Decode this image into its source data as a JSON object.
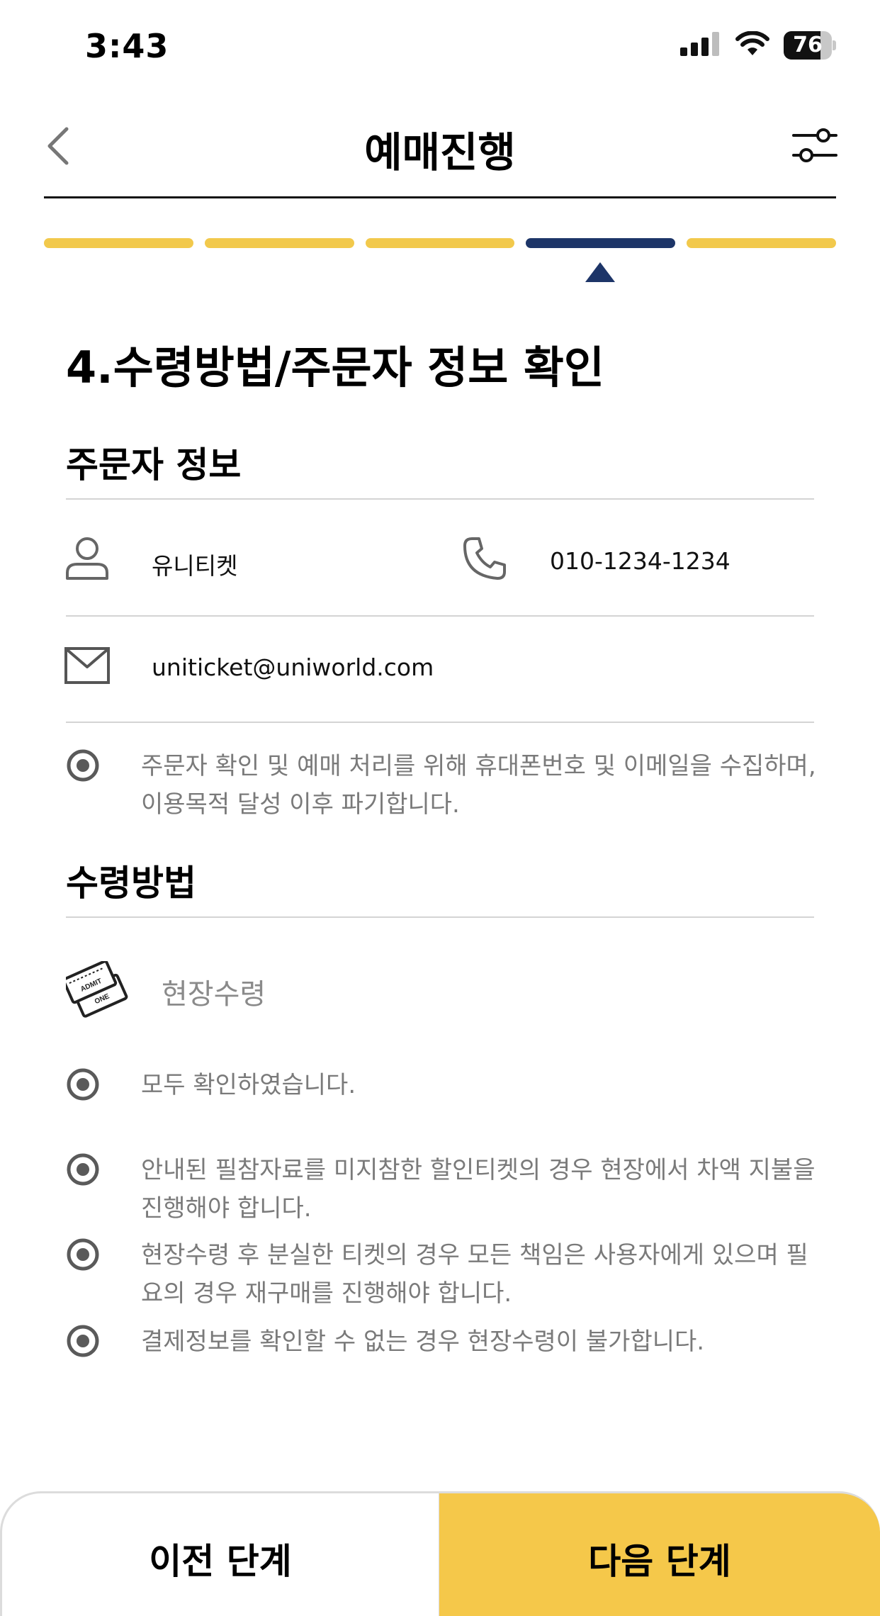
{
  "status_bar": {
    "time": "3:43",
    "battery": "76",
    "battery_level": 0.76,
    "icons": [
      "cellular-signal-icon",
      "wifi-icon",
      "battery-icon"
    ]
  },
  "header": {
    "title": "예매진행",
    "back_icon": "chevron-left-icon",
    "filter_icon": "sliders-icon"
  },
  "progress": {
    "total_steps": 5,
    "current_step": 4,
    "colors": {
      "done": "#f2c94c",
      "active": "#1d3568"
    }
  },
  "step_heading": "4.수령방법/주문자 정보 확인",
  "orderer": {
    "section_title": "주문자 정보",
    "name": "유니티켓",
    "phone": "010-1234-1234",
    "email": "uniticket@uniworld.com",
    "notice": "주문자 확인 및 예매 처리를 위해 휴대폰번호 및 이메일을 수집하며, 이용목적 달성 이후 파기합니다."
  },
  "receive": {
    "section_title": "수령방법",
    "method": "현장수령",
    "notes": [
      "모두 확인하였습니다.",
      "안내된 필참자료를 미지참한 할인티켓의 경우 현장에서 차액 지불을 진행해야 합니다.",
      "현장수령 후 분실한 티켓의 경우 모든 책임은 사용자에게 있으며 필요의 경우 재구매를 진행해야 합니다.",
      "결제정보를 확인할 수 없는 경우 현장수령이 불가합니다."
    ]
  },
  "buttons": {
    "prev": "이전 단계",
    "next": "다음 단계",
    "next_color": "#f5c84a"
  }
}
